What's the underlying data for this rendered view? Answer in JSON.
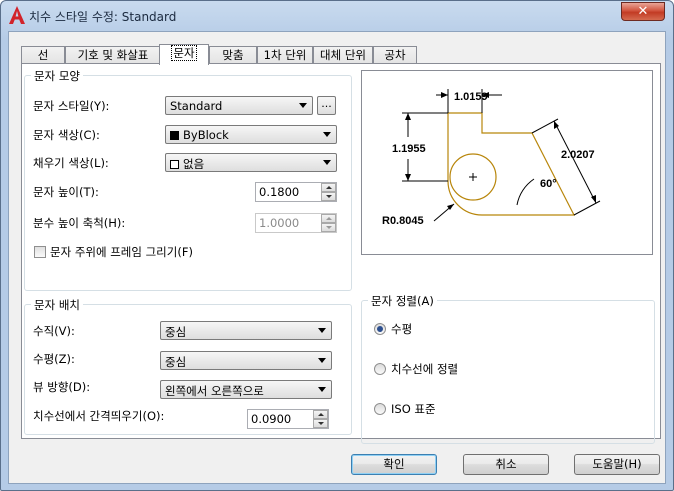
{
  "window": {
    "title": "치수 스타일 수정: Standard",
    "close_glyph": "✕",
    "accent": "#c23b24"
  },
  "tabs": [
    {
      "label": "선"
    },
    {
      "label": "기호 및 화살표"
    },
    {
      "label": "문자"
    },
    {
      "label": "맞춤"
    },
    {
      "label": "1차 단위"
    },
    {
      "label": "대체 단위"
    },
    {
      "label": "공차"
    }
  ],
  "text_appearance": {
    "group_title": "문자 모양",
    "style_label": "문자 스타일(Y):",
    "style_value": "Standard",
    "ellipsis": "...",
    "color_label": "문자 색상(C):",
    "color_value": "ByBlock",
    "fill_label": "채우기 색상(L):",
    "fill_value": "없음",
    "height_label": "문자 높이(T):",
    "height_value": "0.1800",
    "fraction_label": "분수 높이 축척(H):",
    "fraction_value": "1.0000",
    "frame_label": "문자 주위에 프레임 그리기(F)"
  },
  "text_placement": {
    "group_title": "문자 배치",
    "vertical_label": "수직(V):",
    "vertical_value": "중심",
    "horizontal_label": "수평(Z):",
    "horizontal_value": "중심",
    "view_dir_label": "뷰 방향(D):",
    "view_dir_value": "왼쪽에서 오른쪽으로",
    "offset_label": "치수선에서 간격띄우기(O):",
    "offset_value": "0.0900"
  },
  "text_alignment": {
    "group_title": "문자 정렬(A)",
    "options": [
      {
        "label": "수평",
        "selected": true
      },
      {
        "label": "치수선에 정렬",
        "selected": false
      },
      {
        "label": "ISO 표준",
        "selected": false
      }
    ]
  },
  "preview": {
    "dim_top": "1.0159",
    "dim_left": "1.1955",
    "dim_right": "2.0207",
    "angle": "60°",
    "radius": "R0.8045",
    "shape_color": "#b8860b"
  },
  "buttons": {
    "ok": "확인",
    "cancel": "취소",
    "help": "도움말(H)"
  }
}
